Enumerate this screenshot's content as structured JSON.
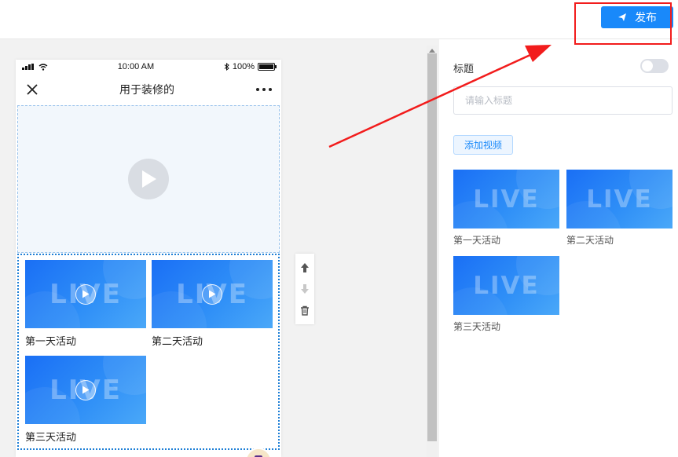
{
  "header": {
    "publish_label": "发布"
  },
  "phone": {
    "status": {
      "time": "10:00 AM",
      "battery": "100%"
    },
    "nav_title": "用于装修的",
    "thumb_text": "LIVE",
    "videos": [
      {
        "label": "第一天活动"
      },
      {
        "label": "第二天活动"
      },
      {
        "label": "第三天活动"
      }
    ]
  },
  "panel": {
    "title_label": "标题",
    "title_placeholder": "请输入标题",
    "add_video_label": "添加视频",
    "videos": [
      {
        "label": "第一天活动"
      },
      {
        "label": "第二天活动"
      },
      {
        "label": "第三天活动"
      }
    ]
  },
  "colors": {
    "accent": "#1989fa",
    "annotation": "#f21c1c",
    "selection_border": "#1e7fd6",
    "thumb_blue": "#1a6ff5"
  }
}
